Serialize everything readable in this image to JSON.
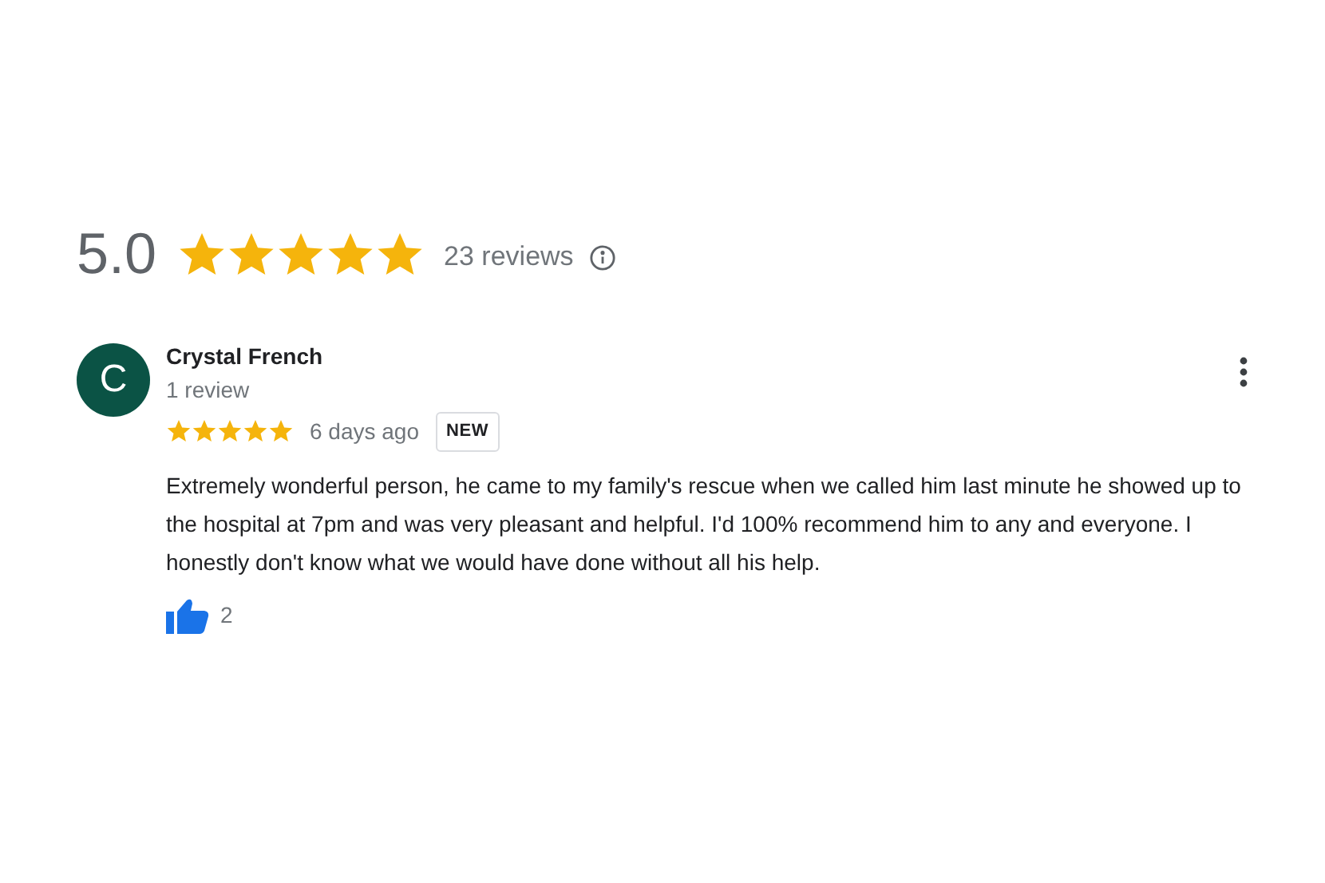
{
  "summary": {
    "rating": "5.0",
    "stars": 5,
    "count": "23 reviews"
  },
  "review": {
    "avatar_letter": "C",
    "author": "Crystal French",
    "author_meta": "1 review",
    "stars": 5,
    "time": "6 days ago",
    "badge": "NEW",
    "text": "Extremely wonderful person, he came to my family's rescue when we called him last minute he showed up to the hospital at 7pm and was very pleasant and helpful. I'd 100% recommend him to any and everyone. I honestly don't know what we would have done without all his help.",
    "likes": "2"
  }
}
